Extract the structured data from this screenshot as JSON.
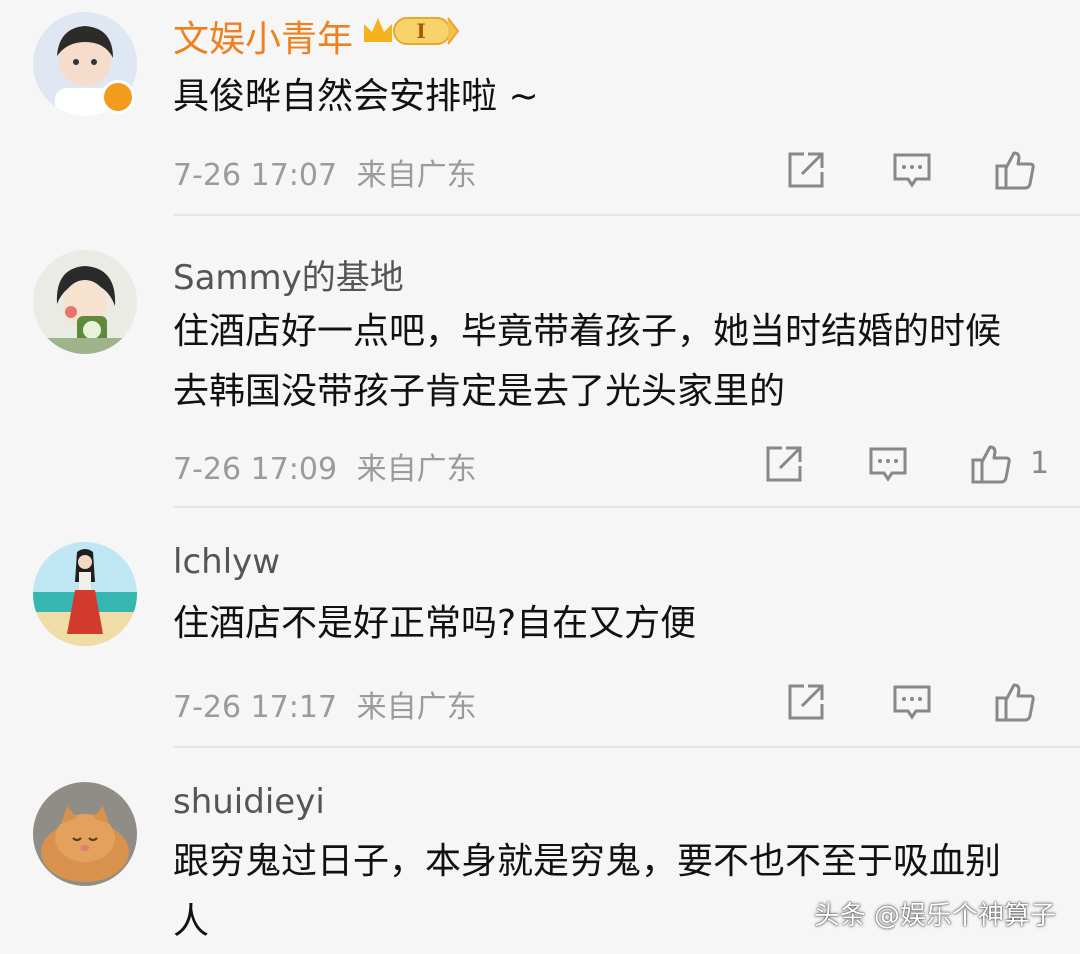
{
  "comments": [
    {
      "username": "文娱小青年",
      "badge_text": "I",
      "content": "具俊晔自然会安排啦 ~",
      "timestamp": "7-26 17:07",
      "location": "来自广东",
      "likes": ""
    },
    {
      "username": "Sammy的基地",
      "content": "住酒店好一点吧，毕竟带着孩子，她当时结婚的时候去韩国没带孩子肯定是去了光头家里的",
      "timestamp": "7-26 17:09",
      "location": "来自广东",
      "likes": "1"
    },
    {
      "username": "lchlyw",
      "content": "住酒店不是好正常吗?自在又方便",
      "timestamp": "7-26 17:17",
      "location": "来自广东",
      "likes": ""
    },
    {
      "username": "shuidieyi",
      "content": "跟穷鬼过日子，本身就是穷鬼，要不也不至于吸血别人",
      "timestamp": "",
      "location": "",
      "likes": ""
    }
  ],
  "watermark": "头条 @娱乐个神算子",
  "colors": {
    "vip_name": "#f07f1e",
    "text": "#111111",
    "meta": "#9b9b9b",
    "background": "#f6f6f6"
  },
  "icons": [
    "share-icon",
    "reply-icon",
    "like-icon"
  ]
}
